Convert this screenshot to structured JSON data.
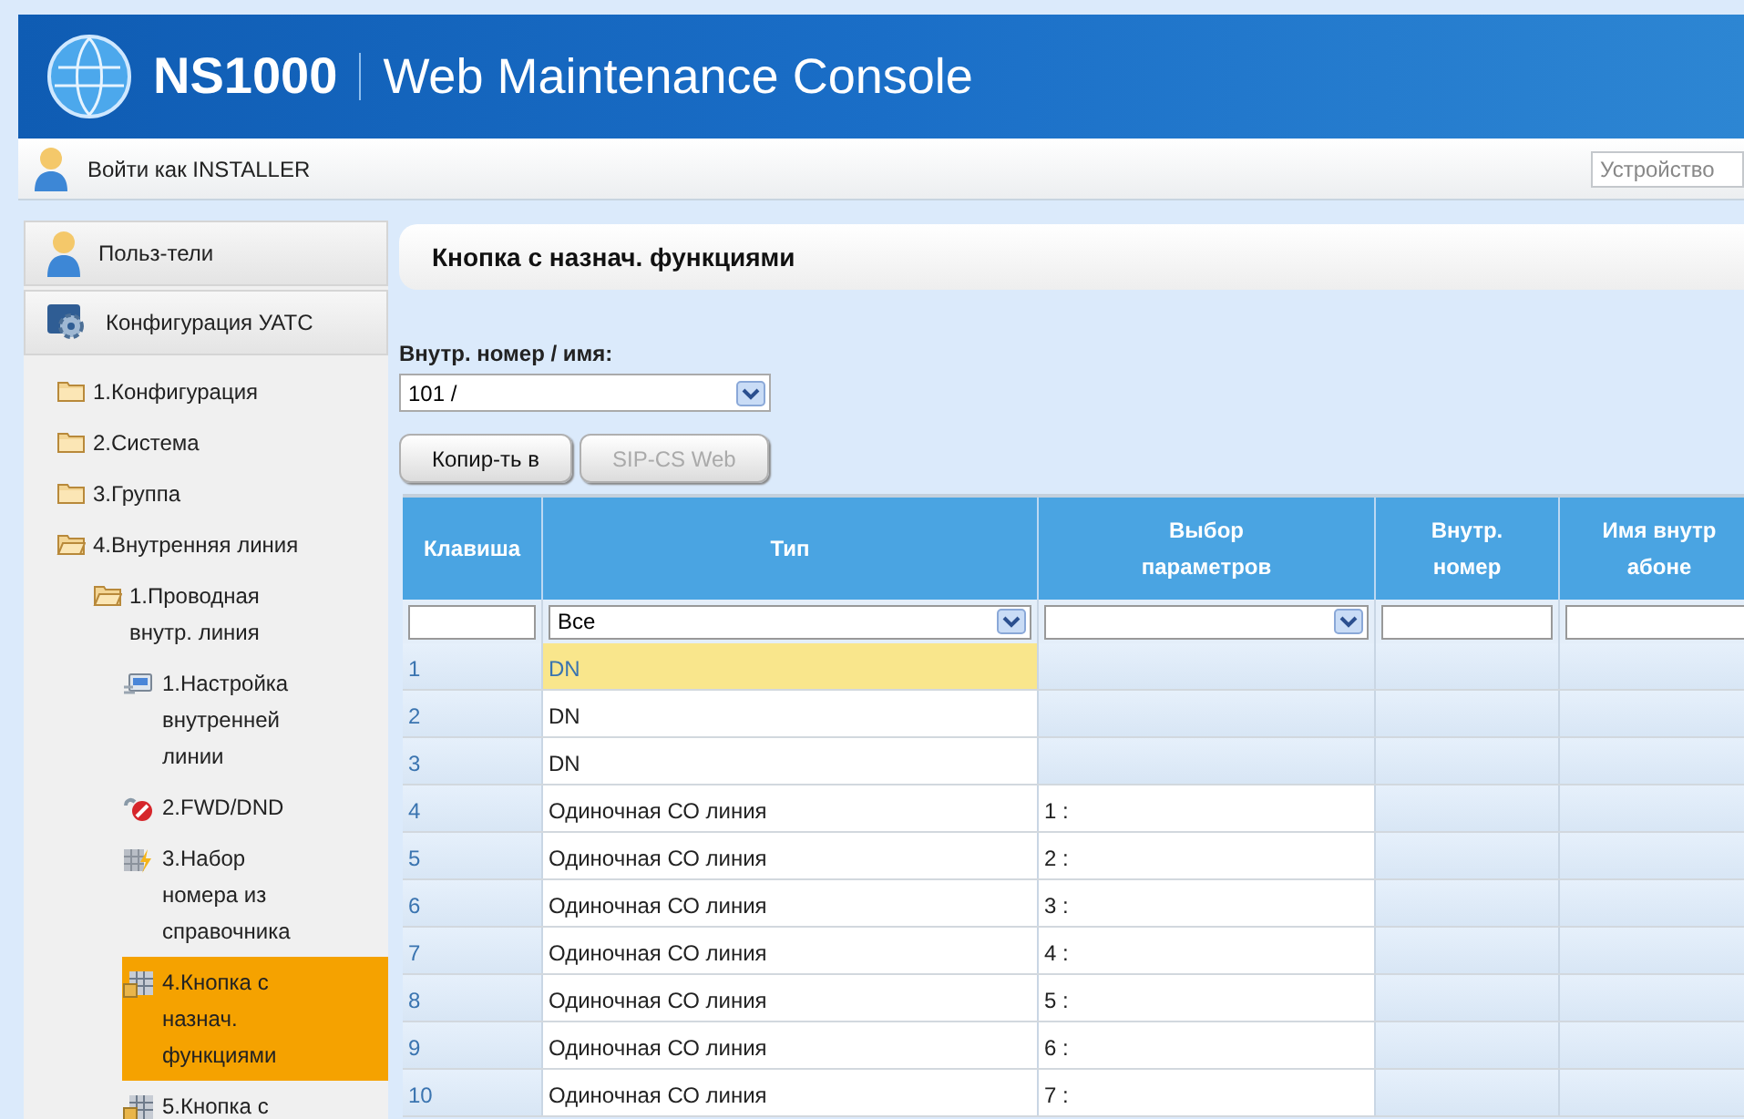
{
  "header": {
    "product": "NS1000",
    "title": "Web Maintenance Console"
  },
  "login_bar": {
    "user": "Войти как INSTALLER",
    "device_field": "Устройство"
  },
  "sidebar": {
    "panels": [
      {
        "label": "Польз-тели",
        "kind": "users"
      },
      {
        "label": "Конфигурация УАТС",
        "kind": "config"
      }
    ],
    "tree": [
      {
        "label": "1.Конфигурация",
        "expanded": false,
        "selected": false
      },
      {
        "label": "2.Система",
        "expanded": false,
        "selected": false
      },
      {
        "label": "3.Группа",
        "expanded": false,
        "selected": false
      },
      {
        "label": "4.Внутренняя линия",
        "expanded": true,
        "selected": false,
        "children": [
          {
            "label": "1.Проводная внутр. линия",
            "expanded": true,
            "selected": false,
            "children": [
              {
                "label": "1.Настройка внутренней линии",
                "kind": "settings",
                "selected": false
              },
              {
                "label": "2.FWD/DND",
                "kind": "forward",
                "selected": false
              },
              {
                "label": "3.Набор номера из справочника",
                "kind": "dial",
                "selected": false
              },
              {
                "label": "4.Кнопка с назнач. функциями",
                "kind": "keys",
                "selected": true
              },
              {
                "label": "5.Кнопка с",
                "kind": "keys",
                "selected": false
              }
            ]
          }
        ]
      }
    ]
  },
  "page": {
    "title": "Кнопка с назнач. функциями",
    "extension_label": "Внутр. номер / имя:",
    "extension_value": "101 /",
    "buttons": [
      {
        "label": "Копир-ть в",
        "disabled": false
      },
      {
        "label": "SIP-CS Web",
        "disabled": true
      }
    ]
  },
  "table": {
    "columns": [
      {
        "lines": [
          "Клавиша"
        ]
      },
      {
        "lines": [
          "Тип"
        ]
      },
      {
        "lines": [
          "Выбор",
          "параметров"
        ]
      },
      {
        "lines": [
          "Внутр.",
          "номер"
        ]
      },
      {
        "lines": [
          "Имя внутр",
          "абоне"
        ]
      }
    ],
    "filters": [
      {
        "kind": "text"
      },
      {
        "kind": "select",
        "value": "Все"
      },
      {
        "kind": "select"
      },
      {
        "kind": "text"
      },
      {
        "kind": "text"
      }
    ],
    "rows": [
      {
        "key": "1",
        "type": "DN",
        "param": "",
        "param_enabled": false,
        "selected": true
      },
      {
        "key": "2",
        "type": "DN",
        "param": "",
        "param_enabled": false,
        "selected": false
      },
      {
        "key": "3",
        "type": "DN",
        "param": "",
        "param_enabled": false,
        "selected": false
      },
      {
        "key": "4",
        "type": "Одиночная СО линия",
        "param": "1 :",
        "param_enabled": true,
        "selected": false
      },
      {
        "key": "5",
        "type": "Одиночная СО линия",
        "param": "2 :",
        "param_enabled": true,
        "selected": false
      },
      {
        "key": "6",
        "type": "Одиночная СО линия",
        "param": "3 :",
        "param_enabled": true,
        "selected": false
      },
      {
        "key": "7",
        "type": "Одиночная СО линия",
        "param": "4 :",
        "param_enabled": true,
        "selected": false
      },
      {
        "key": "8",
        "type": "Одиночная СО линия",
        "param": "5 :",
        "param_enabled": true,
        "selected": false
      },
      {
        "key": "9",
        "type": "Одиночная СО линия",
        "param": "6 :",
        "param_enabled": true,
        "selected": false
      },
      {
        "key": "10",
        "type": "Одиночная СО линия",
        "param": "7 :",
        "param_enabled": true,
        "selected": false
      }
    ]
  }
}
